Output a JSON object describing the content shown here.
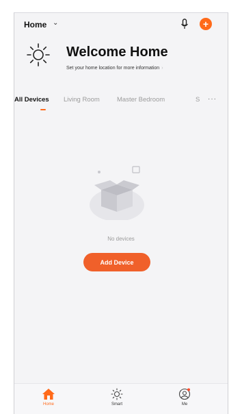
{
  "header": {
    "home_label": "Home",
    "dropdown_icon": "chevron-down-icon",
    "mic_icon": "microphone-icon",
    "add_icon": "plus-circle-icon",
    "accent_color": "#ff6a1a"
  },
  "welcome": {
    "icon": "sun-icon",
    "title": "Welcome Home",
    "subtitle": "Set your home location for more information",
    "chevron": "›"
  },
  "tabs": {
    "items": [
      {
        "label": "All Devices",
        "active": true
      },
      {
        "label": "Living Room",
        "active": false
      },
      {
        "label": "Master Bedroom",
        "active": false
      },
      {
        "label": "S",
        "active": false
      }
    ],
    "more": "···"
  },
  "empty_state": {
    "illustration": "empty-box-icon",
    "message": "No devices",
    "add_button": "Add Device",
    "button_color": "#f0602a"
  },
  "bottom_nav": {
    "items": [
      {
        "label": "Home",
        "icon": "home-icon",
        "active": true
      },
      {
        "label": "Smart",
        "icon": "sun-icon",
        "active": false
      },
      {
        "label": "Me",
        "icon": "profile-icon",
        "active": false
      }
    ]
  }
}
